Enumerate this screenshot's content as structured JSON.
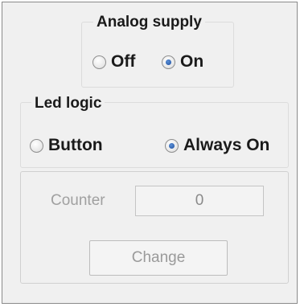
{
  "analog_supply": {
    "title": "Analog supply",
    "options": [
      {
        "label": "Off",
        "selected": false
      },
      {
        "label": "On",
        "selected": true
      }
    ]
  },
  "led_logic": {
    "title": "Led logic",
    "options": [
      {
        "label": "Button",
        "selected": false
      },
      {
        "label": "Always On",
        "selected": true
      }
    ]
  },
  "counter": {
    "label": "Counter",
    "value": "0",
    "change_label": "Change",
    "enabled": false
  },
  "colors": {
    "panel_bg": "#f0f0f0",
    "radio_selected": "#1f4f9e",
    "disabled_text": "#a0a0a0"
  }
}
